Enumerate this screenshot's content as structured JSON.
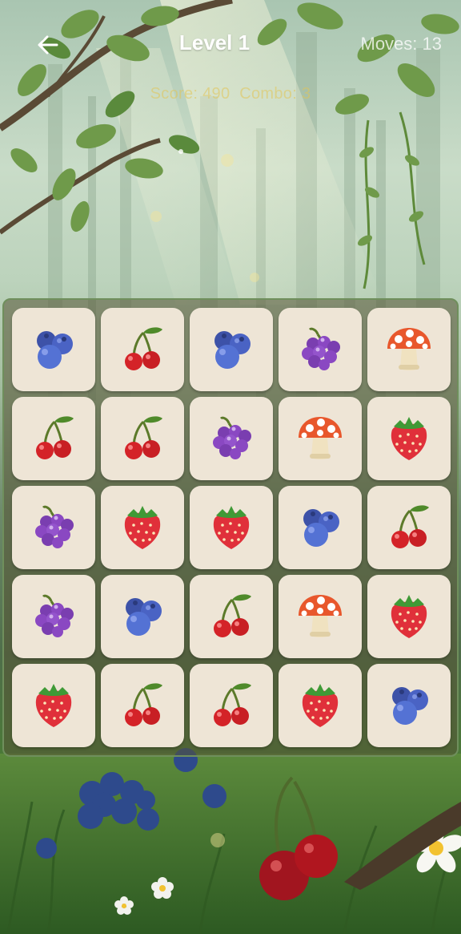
{
  "header": {
    "back_icon": "arrow-left-icon",
    "level_label": "Level 1",
    "moves_label": "Moves: 13"
  },
  "stats": {
    "score_label": "Score: 490",
    "combo_label": "Combo: 3"
  },
  "board": {
    "rows": 5,
    "cols": 5,
    "cells": [
      [
        "blueberry",
        "cherry",
        "blueberry",
        "grapes",
        "mushroom"
      ],
      [
        "cherry",
        "cherry",
        "grapes",
        "mushroom",
        "strawberry"
      ],
      [
        "grapes",
        "strawberry",
        "strawberry",
        "blueberry",
        "cherry"
      ],
      [
        "grapes",
        "blueberry",
        "cherry",
        "mushroom",
        "strawberry"
      ],
      [
        "strawberry",
        "cherry",
        "cherry",
        "strawberry",
        "blueberry"
      ]
    ]
  },
  "colors": {
    "tile": "#eee5d6",
    "board_border": "#6f8f5c",
    "score_text": "#e2c456",
    "title_text": "#ffffff"
  }
}
